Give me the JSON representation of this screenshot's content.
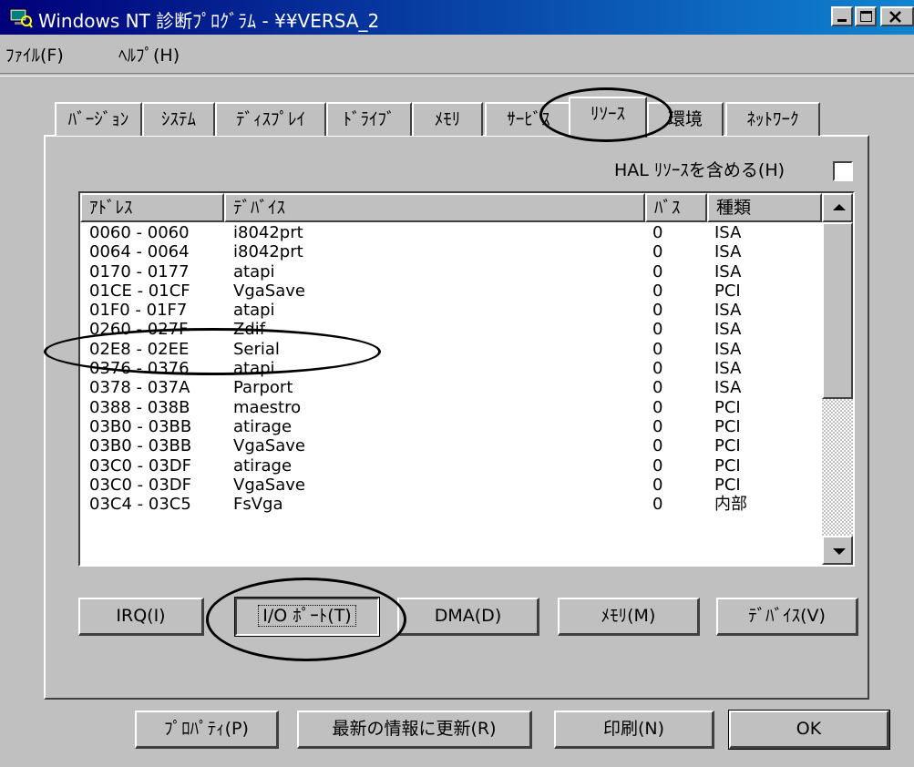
{
  "window": {
    "title": "Windows NT 診断ﾌﾟﾛｸﾞﾗﾑ - ¥¥VERSA_2",
    "controls": [
      "minimize",
      "maximize",
      "close"
    ]
  },
  "menu": [
    {
      "label": "ﾌｧｲﾙ(F)"
    },
    {
      "label": "ﾍﾙﾌﾟ(H)"
    }
  ],
  "tabs": [
    {
      "label": "ﾊﾞｰｼﾞｮﾝ"
    },
    {
      "label": "ｼｽﾃﾑ"
    },
    {
      "label": "ﾃﾞｨｽﾌﾟﾚｲ"
    },
    {
      "label": "ﾄﾞﾗｲﾌﾞ"
    },
    {
      "label": "ﾒﾓﾘ"
    },
    {
      "label": "ｻｰﾋﾞｽ"
    },
    {
      "label": "ﾘｿｰｽ",
      "active": true
    },
    {
      "label": "環境"
    },
    {
      "label": "ﾈｯﾄﾜｰｸ"
    }
  ],
  "hal": {
    "label": "HAL ﾘｿｰｽを含める(H)",
    "checked": false
  },
  "list": {
    "columns": [
      "ｱﾄﾞﾚｽ",
      "ﾃﾞﾊﾞｲｽ",
      "ﾊﾞｽ",
      "種類"
    ],
    "rows": [
      [
        "0060 - 0060",
        "i8042prt",
        "0",
        "ISA"
      ],
      [
        "0064 - 0064",
        "i8042prt",
        "0",
        "ISA"
      ],
      [
        "0170 - 0177",
        "atapi",
        "0",
        "ISA"
      ],
      [
        "01CE - 01CF",
        "VgaSave",
        "0",
        "PCI"
      ],
      [
        "01F0 - 01F7",
        "atapi",
        "0",
        "ISA"
      ],
      [
        "0260 - 027F",
        "Zdif",
        "0",
        "ISA"
      ],
      [
        "02E8 - 02EE",
        "Serial",
        "0",
        "ISA"
      ],
      [
        "0376 - 0376",
        "atapi",
        "0",
        "ISA"
      ],
      [
        "0378 - 037A",
        "Parport",
        "0",
        "ISA"
      ],
      [
        "0388 - 038B",
        "maestro",
        "0",
        "PCI"
      ],
      [
        "03B0 - 03BB",
        "atirage",
        "0",
        "PCI"
      ],
      [
        "03B0 - 03BB",
        "VgaSave",
        "0",
        "PCI"
      ],
      [
        "03C0 - 03DF",
        "atirage",
        "0",
        "PCI"
      ],
      [
        "03C0 - 03DF",
        "VgaSave",
        "0",
        "PCI"
      ],
      [
        "03C4 - 03C5",
        "FsVga",
        "0",
        "内部"
      ]
    ]
  },
  "resource_buttons": [
    {
      "label": "IRQ(I)"
    },
    {
      "label": "I/O ﾎﾟｰﾄ(T)",
      "pressed": true
    },
    {
      "label": "DMA(D)"
    },
    {
      "label": "ﾒﾓﾘ(M)"
    },
    {
      "label": "ﾃﾞﾊﾞｲｽ(V)"
    }
  ],
  "bottom_buttons": [
    {
      "label": "ﾌﾟﾛﾊﾟﾃｨ(P)"
    },
    {
      "label": "最新の情報に更新(R)"
    },
    {
      "label": "印刷(N)"
    },
    {
      "label": "OK"
    }
  ]
}
